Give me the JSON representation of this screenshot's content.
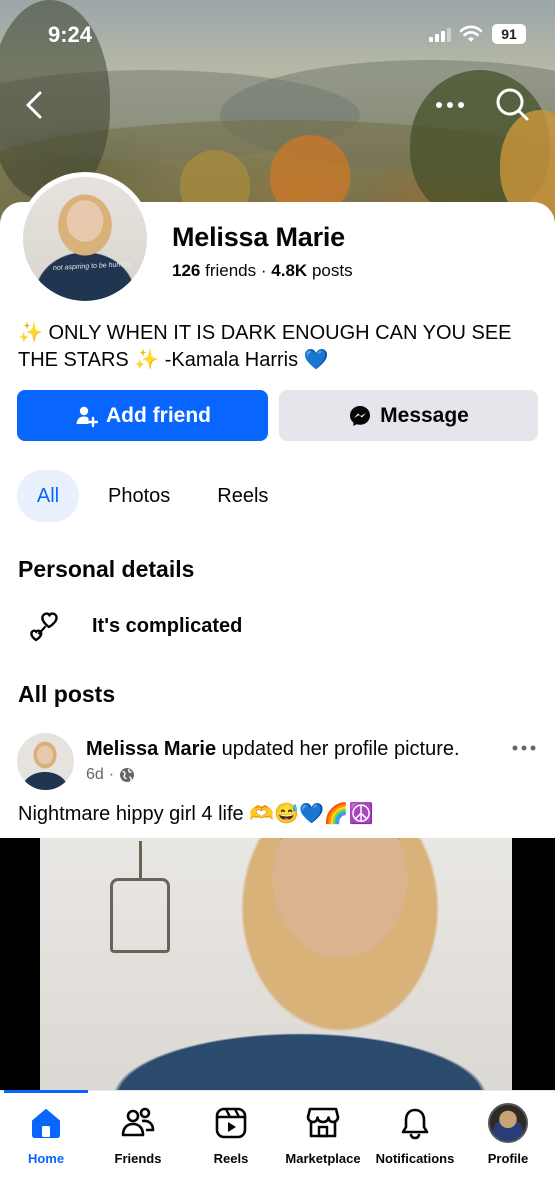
{
  "status_bar": {
    "time": "9:24",
    "battery": "91"
  },
  "profile": {
    "name": "Melissa Marie",
    "friends_count": "126",
    "friends_label": "friends",
    "separator": "·",
    "posts_count": "4.8K",
    "posts_label": "posts",
    "avatar_shirt_text": "not aspiring to be humble",
    "bio": "✨ ONLY WHEN IT IS DARK ENOUGH CAN YOU SEE THE STARS ✨ -Kamala Harris 💙"
  },
  "actions": {
    "add_friend": "Add friend",
    "message": "Message"
  },
  "tabs": [
    {
      "label": "All",
      "active": true
    },
    {
      "label": "Photos",
      "active": false
    },
    {
      "label": "Reels",
      "active": false
    }
  ],
  "personal_details": {
    "heading": "Personal details",
    "relationship": "It's complicated"
  },
  "posts": {
    "heading": "All posts",
    "items": [
      {
        "author": "Melissa Marie",
        "action": "updated her profile picture.",
        "time": "6d",
        "separator": "·",
        "text": "Nightmare hippy girl 4 life 🫶😅💙🌈☮️"
      }
    ]
  },
  "bottom_nav": [
    {
      "label": "Home",
      "icon": "home-icon",
      "active": true
    },
    {
      "label": "Friends",
      "icon": "friends-icon",
      "active": false
    },
    {
      "label": "Reels",
      "icon": "reels-icon",
      "active": false
    },
    {
      "label": "Marketplace",
      "icon": "marketplace-icon",
      "active": false
    },
    {
      "label": "Notifications",
      "icon": "bell-icon",
      "active": false
    },
    {
      "label": "Profile",
      "icon": "profile-avatar",
      "active": false
    }
  ],
  "colors": {
    "accent": "#0866ff",
    "secondary_button": "#e4e6eb",
    "active_tab_bg": "#e7f0fb",
    "muted_text": "#65676b"
  }
}
